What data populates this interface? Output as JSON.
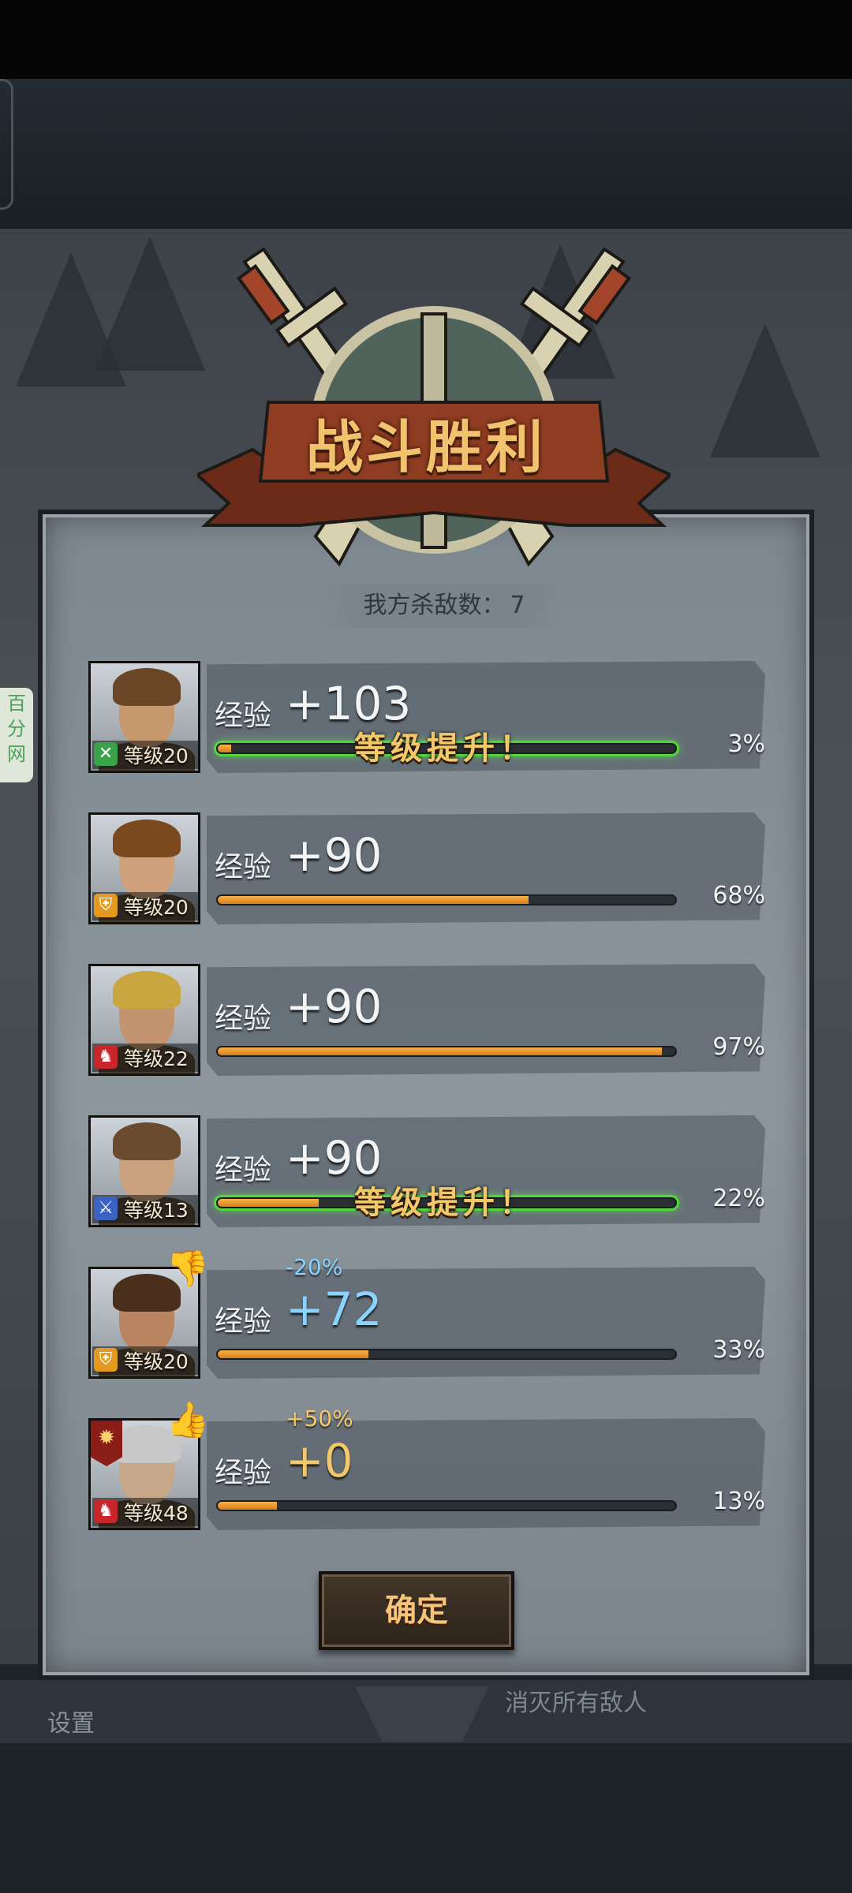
{
  "title": "战斗胜利",
  "kills": {
    "label": "我方杀敌数：",
    "value": "7"
  },
  "side_tag": "百分网",
  "under_ui": {
    "settings_label": "设置",
    "skill_label": "消灭所有敌人"
  },
  "confirm_label": "确定",
  "colors": {
    "bar_fill": "#e1902a",
    "level_up_glow": "#51d73c",
    "penalty": "#8ad3ff",
    "bonus": "#f3c86a"
  },
  "heroes": [
    {
      "level": "等级20",
      "class_icon": "crossed-swords-icon",
      "exp_label": "经验",
      "exp": "+103",
      "progress": 0.03,
      "percent": "3%",
      "level_up": "等级提升！",
      "modifier": ""
    },
    {
      "level": "等级20",
      "class_icon": "shield-icon",
      "exp_label": "经验",
      "exp": "+90",
      "progress": 0.68,
      "percent": "68%",
      "level_up": "",
      "modifier": ""
    },
    {
      "level": "等级22",
      "class_icon": "horse-icon",
      "exp_label": "经验",
      "exp": "+90",
      "progress": 0.97,
      "percent": "97%",
      "level_up": "",
      "modifier": ""
    },
    {
      "level": "等级13",
      "class_icon": "sword-icon",
      "exp_label": "经验",
      "exp": "+90",
      "progress": 0.22,
      "percent": "22%",
      "level_up": "等级提升！",
      "modifier": ""
    },
    {
      "level": "等级20",
      "class_icon": "shield-icon",
      "exp_label": "经验",
      "exp": "+72",
      "progress": 0.33,
      "percent": "33%",
      "level_up": "",
      "modifier": "-20%",
      "mood_icon": "thumbs-down-icon"
    },
    {
      "level": "等级48",
      "class_icon": "horse-icon",
      "exp_label": "经验",
      "exp": "+0",
      "progress": 0.13,
      "percent": "13%",
      "level_up": "",
      "modifier": "+50%",
      "mood_icon": "thumbs-up-icon"
    }
  ]
}
